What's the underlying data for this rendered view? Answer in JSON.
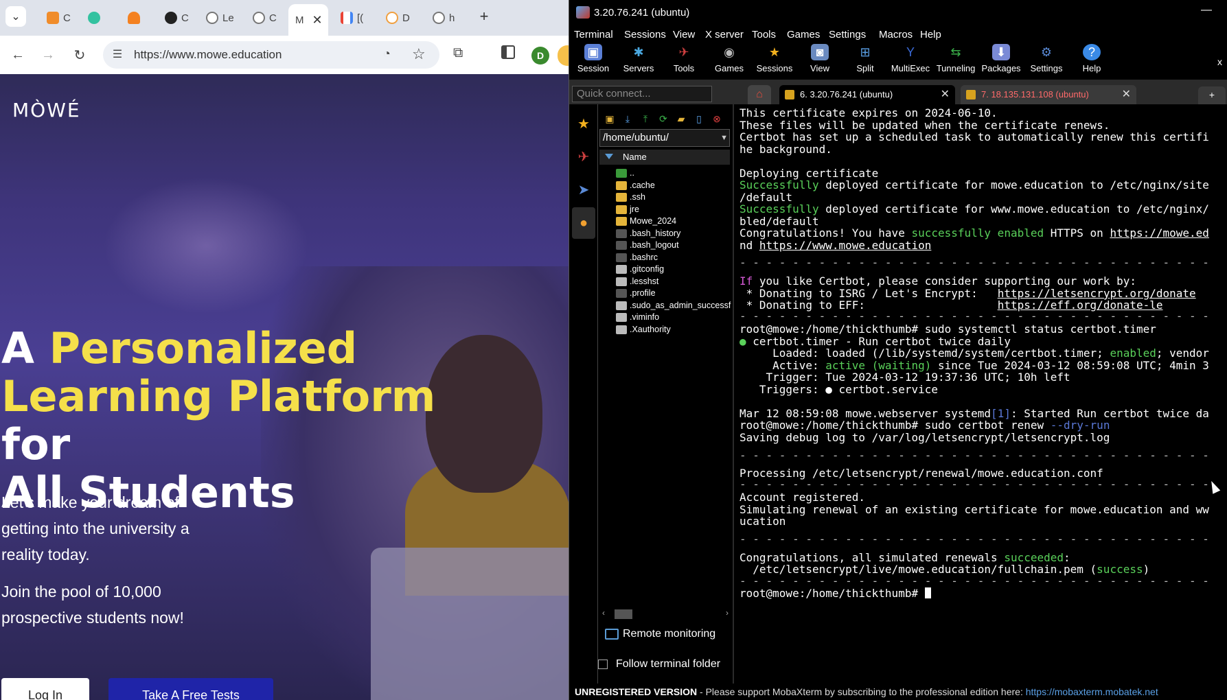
{
  "browser": {
    "tabs": [
      {
        "label": "C",
        "favicon_color": "#f08c2a"
      },
      {
        "label": "",
        "favicon_color": "#33c2a0"
      },
      {
        "label": "",
        "favicon_color": "#f48120"
      },
      {
        "label": "C",
        "favicon_color": "#222222"
      },
      {
        "label": "Le",
        "favicon_color": "#777777"
      },
      {
        "label": "C",
        "favicon_color": "#777777"
      },
      {
        "label": "M",
        "favicon_color": "#ffffff"
      },
      {
        "label": "[(",
        "favicon_color": "#ea4335"
      },
      {
        "label": "D",
        "favicon_color": "#f0a040"
      },
      {
        "label": "h",
        "favicon_color": "#777777"
      }
    ],
    "active_tab_close": "✕",
    "new_tab": "+",
    "url": "https://www.mowe.education",
    "profile_initial": "D"
  },
  "website": {
    "logo": "MÒWÉ",
    "hero": {
      "line1_a": "A ",
      "line1_b": "Personalized",
      "line2_a": "Learning Platform",
      "line2_b": " for",
      "line3": "All Students"
    },
    "subtitle1": "Let's make your dream of getting into the university a reality today.",
    "subtitle2": "Join the pool of 10,000 prospective students now!",
    "login_label": "Log In",
    "test_label": "Take A Free Tests"
  },
  "moba": {
    "window_title": "3.20.76.241 (ubuntu)",
    "menu": [
      "Terminal",
      "Sessions",
      "View",
      "X server",
      "Tools",
      "Games",
      "Settings",
      "Macros",
      "Help"
    ],
    "ribbon": [
      {
        "label": "Session",
        "icon": "session-icon",
        "color": "#5b7fd6"
      },
      {
        "label": "Servers",
        "icon": "servers-icon",
        "color": "#4aa8e0"
      },
      {
        "label": "Tools",
        "icon": "tools-icon",
        "color": "#d04040"
      },
      {
        "label": "Games",
        "icon": "games-icon",
        "color": "#bbbbbb"
      },
      {
        "label": "Sessions",
        "icon": "star-icon",
        "color": "#f2b01e"
      },
      {
        "label": "View",
        "icon": "view-icon",
        "color": "#6a8ac0"
      },
      {
        "label": "Split",
        "icon": "split-icon",
        "color": "#5aa0e6"
      },
      {
        "label": "MultiExec",
        "icon": "multiexec-icon",
        "color": "#3a6ad6"
      },
      {
        "label": "Tunneling",
        "icon": "tunneling-icon",
        "color": "#3ab04a"
      },
      {
        "label": "Packages",
        "icon": "packages-icon",
        "color": "#7a8ad6"
      },
      {
        "label": "Settings",
        "icon": "settings-icon",
        "color": "#5a8ad6"
      },
      {
        "label": "Help",
        "icon": "help-icon",
        "color": "#3a8ae6"
      }
    ],
    "close_ribbon": "x",
    "quick_connect_placeholder": "Quick connect...",
    "session_tabs": [
      {
        "label": "6. 3.20.76.241 (ubuntu)"
      },
      {
        "label": "7. 18.135.131.108 (ubuntu)"
      }
    ],
    "sftp": {
      "path": "/home/ubuntu/",
      "column": "Name",
      "files": [
        {
          "name": "..",
          "type": "up"
        },
        {
          "name": ".cache",
          "type": "folder"
        },
        {
          "name": ".ssh",
          "type": "folder"
        },
        {
          "name": "jre",
          "type": "folder"
        },
        {
          "name": "Mowe_2024",
          "type": "folder"
        },
        {
          "name": ".bash_history",
          "type": "file"
        },
        {
          "name": ".bash_logout",
          "type": "file"
        },
        {
          "name": ".bashrc",
          "type": "file"
        },
        {
          "name": ".gitconfig",
          "type": "doc"
        },
        {
          "name": ".lesshst",
          "type": "doc"
        },
        {
          "name": ".profile",
          "type": "file"
        },
        {
          "name": ".sudo_as_admin_successful",
          "type": "doc"
        },
        {
          "name": ".viminfo",
          "type": "doc"
        },
        {
          "name": ".Xauthority",
          "type": "doc"
        }
      ],
      "remote_monitoring": "Remote monitoring",
      "follow_folder": "Follow terminal folder"
    },
    "terminal": {
      "l01": "This certificate expires on 2024-06-10.",
      "l02": "These files will be updated when the certificate renews.",
      "l03": "Certbot has set up a scheduled task to automatically renew this certifi",
      "l04": "he background.",
      "l05": "Deploying certificate",
      "l06a": "Successfully",
      "l06b": " deployed certificate for mowe.education to /etc/nginx/site",
      "l07": "/default",
      "l08a": "Successfully",
      "l08b": " deployed certificate for www.mowe.education to /etc/nginx/",
      "l09": "bled/default",
      "l10a": "Congratulations! You have ",
      "l10b": "successfully enabled",
      "l10c": " HTTPS on ",
      "l10d": "https://mowe.ed",
      "l11a": "nd ",
      "l11b": "https://www.mowe.education",
      "l12": "- - - - - - - - - - - - - - - - - - - - - - - - - - - - - - - - - - - -",
      "l13a": "If",
      "l13b": " you like Certbot, please consider supporting our work by:",
      "l14a": " * Donating to ISRG / Let's Encrypt:   ",
      "l14b": "https://letsencrypt.org/donate",
      "l15a": " * Donating to EFF:                    ",
      "l15b": "https://eff.org/donate-le",
      "l16": "- - - - - - - - - - - - - - - - - - - - - - - - - - - - - - - - - - - -",
      "l17": "root@mowe:/home/thickthumb# sudo systemctl status certbot.timer",
      "l18a": "●",
      "l18b": " certbot.timer - Run certbot twice daily",
      "l19a": "     Loaded: loaded (/lib/systemd/system/certbot.timer; ",
      "l19b": "enabled",
      "l19c": "; vendor",
      "l20a": "     Active: ",
      "l20b": "active (waiting)",
      "l20c": " since Tue 2024-03-12 08:59:08 UTC; 4min 3",
      "l21": "    Trigger: Tue 2024-03-12 19:37:36 UTC; 10h left",
      "l22": "   Triggers: ● certbot.service",
      "l23a": "Mar 12 08:59:08 mowe.webserver systemd",
      "l23b": "[1]",
      "l23c": ": Started Run certbot twice da",
      "l24a": "root@mowe:/home/thickthumb# sudo certbot renew ",
      "l24b": "--dry-run",
      "l25": "Saving debug log to /var/log/letsencrypt/letsencrypt.log",
      "l26": "- - - - - - - - - - - - - - - - - - - - - - - - - - - - - - - - - - - -",
      "l27": "Processing /etc/letsencrypt/renewal/mowe.education.conf",
      "l28": "- - - - - - - - - - - - - - - - - - - - - - - - - - - - - - - - - - - -",
      "l29": "Account registered.",
      "l30": "Simulating renewal of an existing certificate for mowe.education and ww",
      "l31": "ucation",
      "l32": "- - - - - - - - - - - - - - - - - - - - - - - - - - - - - - - - - - - -",
      "l33a": "Congratulations, all simulated renewals ",
      "l33b": "succeeded",
      "l33c": ":",
      "l34a": "  /etc/letsencrypt/live/mowe.education/fullchain.pem (",
      "l34b": "success",
      "l34c": ")",
      "l35": "- - - - - - - - - - - - - - - - - - - - - - - - - - - - - - - - - - - -",
      "prompt": "root@mowe:/home/thickthumb# "
    },
    "status": {
      "bold": "UNREGISTERED VERSION",
      "text": "  -  Please support MobaXterm by subscribing to the professional edition here:  ",
      "link": "https://mobaxterm.mobatek.net"
    }
  }
}
